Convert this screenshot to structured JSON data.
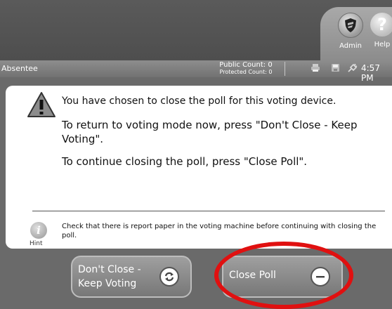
{
  "header": {
    "admin_label": "Admin",
    "help_label": "Help",
    "help_glyph": "?",
    "icons": [
      "shield-icon",
      "help-icon"
    ]
  },
  "status_bar": {
    "mode": "Absentee",
    "public_count": "Public Count: 0",
    "protected_count": "Protected Count: 0",
    "time": "4:57 PM",
    "icons": [
      "printer-icon",
      "save-icon",
      "plug-icon"
    ]
  },
  "dialog": {
    "message_main": "You have chosen to close the poll for this voting device.",
    "message_return": "To return to voting mode now, press \"Don't Close - Keep Voting\".",
    "message_continue": "To continue closing the poll, press \"Close Poll\".",
    "hint_glyph": "i",
    "hint_label": "Hint",
    "hint_text": "Check that there is report paper in the voting machine before continuing with closing the poll."
  },
  "buttons": {
    "keep_voting_line1": "Don't Close -",
    "keep_voting_line2": "Keep Voting",
    "close_poll": "Close Poll"
  },
  "colors": {
    "highlight_ring": "#e01010",
    "button_bg": "#8a8a8a",
    "bar_bg": "#7a7a7a"
  }
}
